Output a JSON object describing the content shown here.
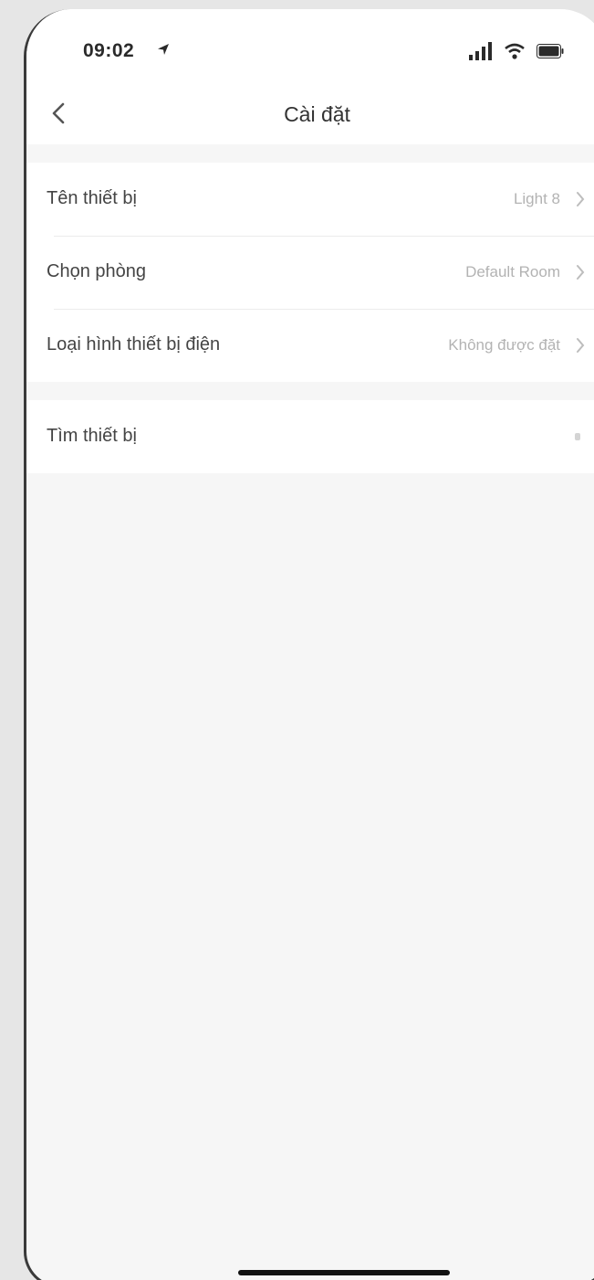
{
  "status_bar": {
    "time": "09:02",
    "icons": [
      "location-arrow-icon",
      "signal-icon",
      "wifi-icon",
      "battery-icon"
    ]
  },
  "nav": {
    "back_icon": "chevron-left-icon",
    "title": "Cài đặt"
  },
  "settings": {
    "group1": [
      {
        "label": "Tên thiết bị",
        "value": "Light 8"
      },
      {
        "label": "Chọn phòng",
        "value": "Default Room"
      },
      {
        "label": "Loại hình thiết bị điện",
        "value": "Không được đặt"
      }
    ],
    "group2": [
      {
        "label": "Tìm thiết bị"
      }
    ]
  },
  "colors": {
    "background": "#f6f6f6",
    "row_background": "#ffffff",
    "label_text": "#444444",
    "value_text": "#b3b3b3"
  }
}
